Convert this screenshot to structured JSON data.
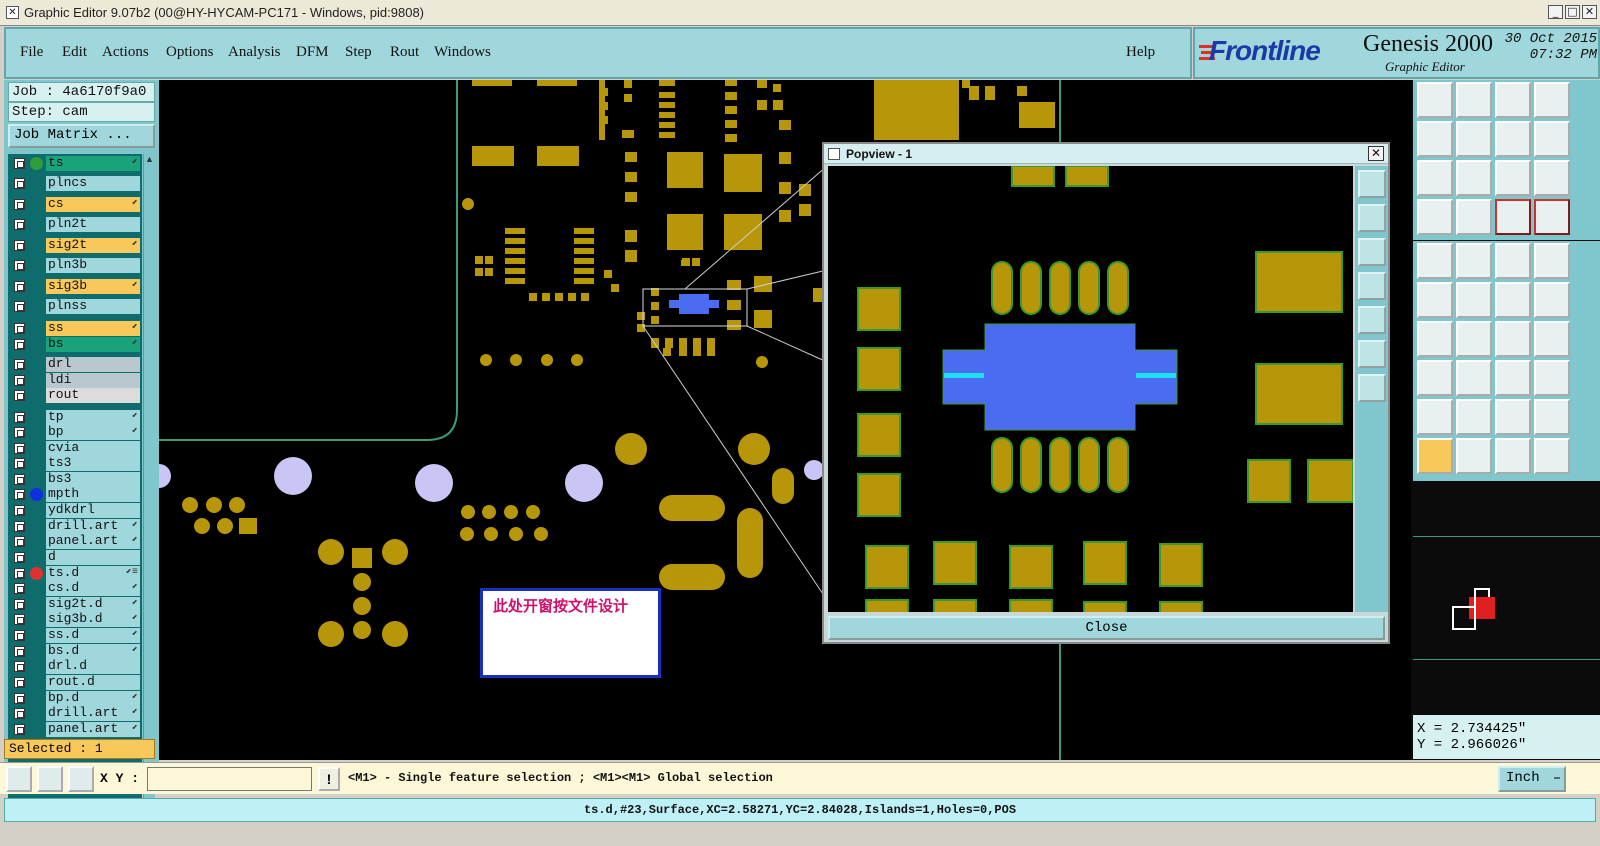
{
  "window": {
    "title": "Graphic Editor 9.07b2 (00@HY-HYCAM-PC171 - Windows, pid:9808)"
  },
  "menu": {
    "items": [
      "File",
      "Edit",
      "Actions",
      "Options",
      "Analysis",
      "DFM",
      "Step",
      "Rout",
      "Windows"
    ],
    "help": "Help"
  },
  "brand": {
    "logo": "Frontline",
    "product": "Genesis 2000",
    "subtitle": "Graphic Editor",
    "date": "30 Oct 2015",
    "time": "07:32 PM"
  },
  "job": {
    "job_label": "Job : 4a6170f9a0",
    "step_label": "Step: cam",
    "matrix_button": "Job Matrix ..."
  },
  "layers": [
    {
      "name": "ts",
      "color": "#1aa37a",
      "dot": "#2e9e3a",
      "arrow": "⬋"
    },
    {
      "name": "plncs",
      "color": "#9fd7dd",
      "dot": "",
      "arrow": ""
    },
    {
      "name": "cs",
      "color": "#f8c95a",
      "dot": "",
      "arrow": "⬋"
    },
    {
      "name": "pln2t",
      "color": "#9fd7dd",
      "dot": "",
      "arrow": ""
    },
    {
      "name": "sig2t",
      "color": "#f8c95a",
      "dot": "",
      "arrow": "⬋"
    },
    {
      "name": "pln3b",
      "color": "#9fd7dd",
      "dot": "",
      "arrow": ""
    },
    {
      "name": "sig3b",
      "color": "#f8c95a",
      "dot": "",
      "arrow": "⬋"
    },
    {
      "name": "plnss",
      "color": "#9fd7dd",
      "dot": "",
      "arrow": ""
    },
    {
      "name": "ss",
      "color": "#f8c95a",
      "dot": "",
      "arrow": "⬋"
    },
    {
      "name": "bs",
      "color": "#1aa37a",
      "dot": "",
      "arrow": "⬋"
    },
    {
      "name": "drl",
      "color": "#b9c7cf",
      "dot": "",
      "arrow": ""
    },
    {
      "name": "ldi",
      "color": "#b9c7cf",
      "dot": "",
      "arrow": ""
    },
    {
      "name": "rout",
      "color": "#dcdcdc",
      "dot": "",
      "arrow": ""
    },
    {
      "name": "tp",
      "color": "#9fd7dd",
      "dot": "",
      "arrow": "⬋"
    },
    {
      "name": "bp",
      "color": "#9fd7dd",
      "dot": "",
      "arrow": "⬋"
    },
    {
      "name": "cvia",
      "color": "#9fd7dd",
      "dot": "",
      "arrow": ""
    },
    {
      "name": "ts3",
      "color": "#9fd7dd",
      "dot": "",
      "arrow": ""
    },
    {
      "name": "bs3",
      "color": "#9fd7dd",
      "dot": "",
      "arrow": ""
    },
    {
      "name": "mpth",
      "color": "#9fd7dd",
      "dot": "#1030e0",
      "arrow": ""
    },
    {
      "name": "ydkdrl",
      "color": "#9fd7dd",
      "dot": "",
      "arrow": ""
    },
    {
      "name": "drill.art",
      "color": "#9fd7dd",
      "dot": "",
      "arrow": "⬋"
    },
    {
      "name": "panel.art",
      "color": "#9fd7dd",
      "dot": "",
      "arrow": "⬋"
    },
    {
      "name": "d",
      "color": "#9fd7dd",
      "dot": "",
      "arrow": ""
    },
    {
      "name": "ts.d",
      "color": "#9fd7dd",
      "dot": "#e03030",
      "arrow": "⬋≡"
    },
    {
      "name": "cs.d",
      "color": "#9fd7dd",
      "dot": "",
      "arrow": "⬋"
    },
    {
      "name": "sig2t.d",
      "color": "#9fd7dd",
      "dot": "",
      "arrow": "⬋"
    },
    {
      "name": "sig3b.d",
      "color": "#9fd7dd",
      "dot": "",
      "arrow": "⬋"
    },
    {
      "name": "ss.d",
      "color": "#9fd7dd",
      "dot": "",
      "arrow": "⬋"
    },
    {
      "name": "bs.d",
      "color": "#9fd7dd",
      "dot": "",
      "arrow": "⬋"
    },
    {
      "name": "drl.d",
      "color": "#9fd7dd",
      "dot": "",
      "arrow": ""
    },
    {
      "name": "rout.d",
      "color": "#9fd7dd",
      "dot": "",
      "arrow": ""
    },
    {
      "name": "bp.d",
      "color": "#9fd7dd",
      "dot": "",
      "arrow": "⬋"
    },
    {
      "name": "drill.art",
      "color": "#9fd7dd",
      "dot": "",
      "arrow": "⬋"
    },
    {
      "name": "panel.art",
      "color": "#9fd7dd",
      "dot": "",
      "arrow": "⬋"
    }
  ],
  "selected": "Selected : 1",
  "annotation": "此处开窗按文件设计",
  "popview": {
    "title": "Popview - 1",
    "close": "Close"
  },
  "coords": {
    "x": "X = 2.734425\"",
    "y": "Y = 2.966026\""
  },
  "bottom": {
    "xy_label": "X Y :",
    "xy_value": "",
    "message": "<M1> - Single feature selection ; <M1><M1> Global selection",
    "unit": "Inch"
  },
  "status": "ts.d,#23,Surface,XC=2.58271,YC=2.84028,Islands=1,Holes=0,POS",
  "colors": {
    "copper": "#b8960a",
    "selected_feature": "#4a6cf0",
    "via": "#c9c6f5",
    "panel": "#7fc7cc"
  }
}
